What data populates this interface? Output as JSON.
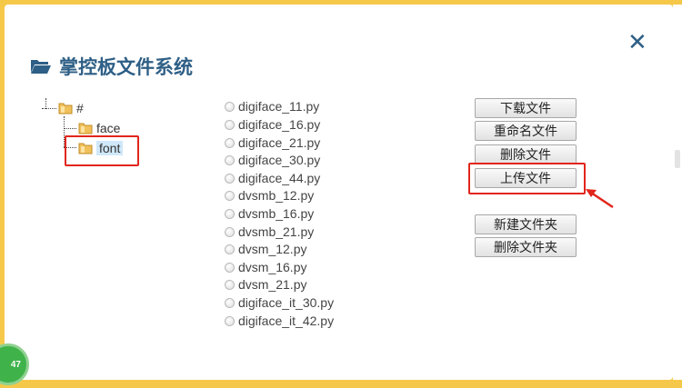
{
  "dialog": {
    "title": "掌控板文件系统",
    "close_symbol": "✕"
  },
  "tree": {
    "root": "#",
    "children": [
      "face",
      "font"
    ],
    "selected": "font"
  },
  "files": [
    "digiface_11.py",
    "digiface_16.py",
    "digiface_21.py",
    "digiface_30.py",
    "digiface_44.py",
    "dvsmb_12.py",
    "dvsmb_16.py",
    "dvsmb_21.py",
    "dvsm_12.py",
    "dvsm_16.py",
    "dvsm_21.py",
    "digiface_it_30.py",
    "digiface_it_42.py"
  ],
  "buttons": {
    "download": "下载文件",
    "rename": "重命名文件",
    "delete": "删除文件",
    "upload": "上传文件",
    "new_folder": "新建文件夹",
    "delete_folder": "删除文件夹"
  },
  "badge": "47",
  "colors": {
    "frame": "#f6c84a",
    "title": "#2e5f86",
    "highlight": "#e1251b",
    "selection": "#cfe8fa"
  },
  "icons": {
    "title": "folder-open-icon",
    "tree_node": "folder-icon"
  }
}
